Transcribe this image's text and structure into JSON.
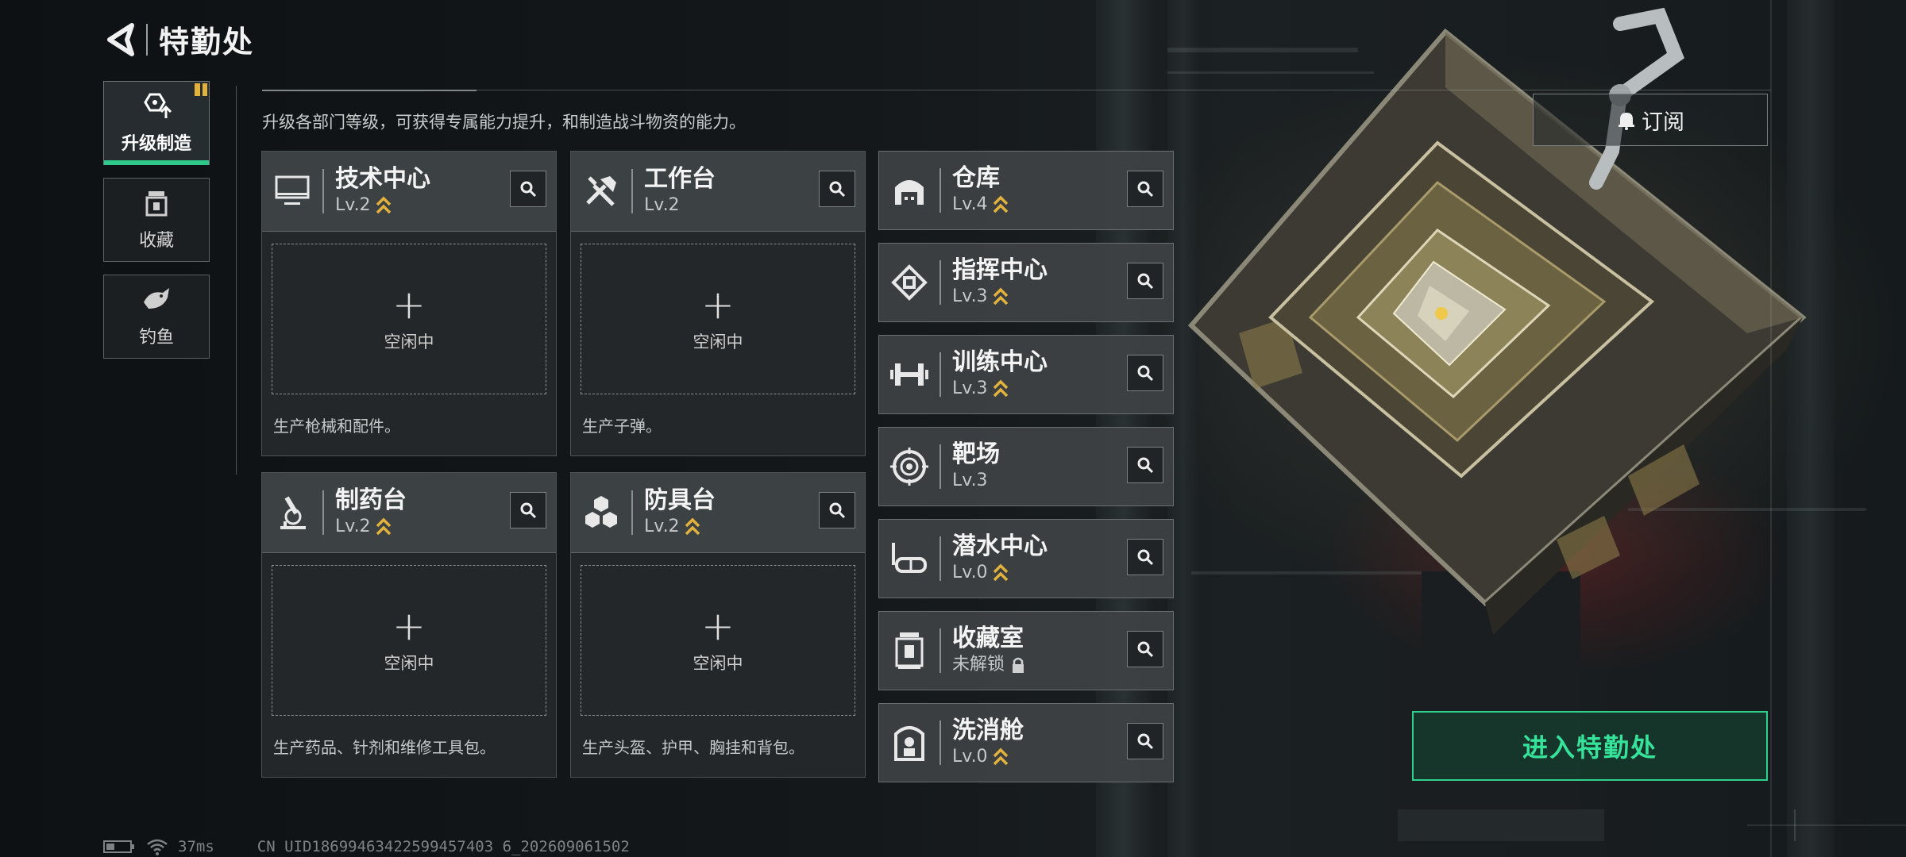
{
  "header": {
    "title": "特勤处"
  },
  "sidenav": {
    "items": [
      {
        "label": "升级制造",
        "icon": "upgrade-icon",
        "active": true
      },
      {
        "label": "收藏",
        "icon": "collection-icon",
        "active": false
      },
      {
        "label": "钓鱼",
        "icon": "fish-icon",
        "active": false
      }
    ]
  },
  "intro": "升级各部门等级，可获得专属能力提升，和制造战斗物资的能力。",
  "big_cards": [
    {
      "title": "技术中心",
      "level": "Lv.2",
      "upgradable": true,
      "icon": "monitor-icon",
      "slot": "空闲中",
      "desc": "生产枪械和配件。"
    },
    {
      "title": "工作台",
      "level": "Lv.2",
      "upgradable": false,
      "icon": "tools-icon",
      "slot": "空闲中",
      "desc": "生产子弹。"
    },
    {
      "title": "制药台",
      "level": "Lv.2",
      "upgradable": true,
      "icon": "microscope-icon",
      "slot": "空闲中",
      "desc": "生产药品、针剂和维修工具包。"
    },
    {
      "title": "防具台",
      "level": "Lv.2",
      "upgradable": true,
      "icon": "armor-icon",
      "slot": "空闲中",
      "desc": "生产头盔、护甲、胸挂和背包。"
    }
  ],
  "small_cards": [
    {
      "title": "仓库",
      "level": "Lv.4",
      "upgradable": true,
      "icon": "warehouse-icon"
    },
    {
      "title": "指挥中心",
      "level": "Lv.3",
      "upgradable": true,
      "icon": "chip-icon"
    },
    {
      "title": "训练中心",
      "level": "Lv.3",
      "upgradable": true,
      "icon": "dumbbell-icon"
    },
    {
      "title": "靶场",
      "level": "Lv.3",
      "upgradable": false,
      "icon": "target-icon"
    },
    {
      "title": "潜水中心",
      "level": "Lv.0",
      "upgradable": true,
      "icon": "diving-mask-icon"
    },
    {
      "title": "收藏室",
      "level": "未解锁",
      "locked": true,
      "icon": "showcase-icon"
    },
    {
      "title": "洗消舱",
      "level": "Lv.0",
      "upgradable": true,
      "icon": "decon-icon"
    }
  ],
  "subscribe": {
    "label": "订阅",
    "icon": "bell-icon"
  },
  "enter_button": {
    "label": "进入特勤处"
  },
  "status": {
    "ping": "37ms",
    "uid": "CN UID18699463422599457403 6_202609061502"
  },
  "colors": {
    "accent": "#2fd18e",
    "upgrade_chevron": "#e2b23c",
    "badge": "#e2b23c"
  }
}
